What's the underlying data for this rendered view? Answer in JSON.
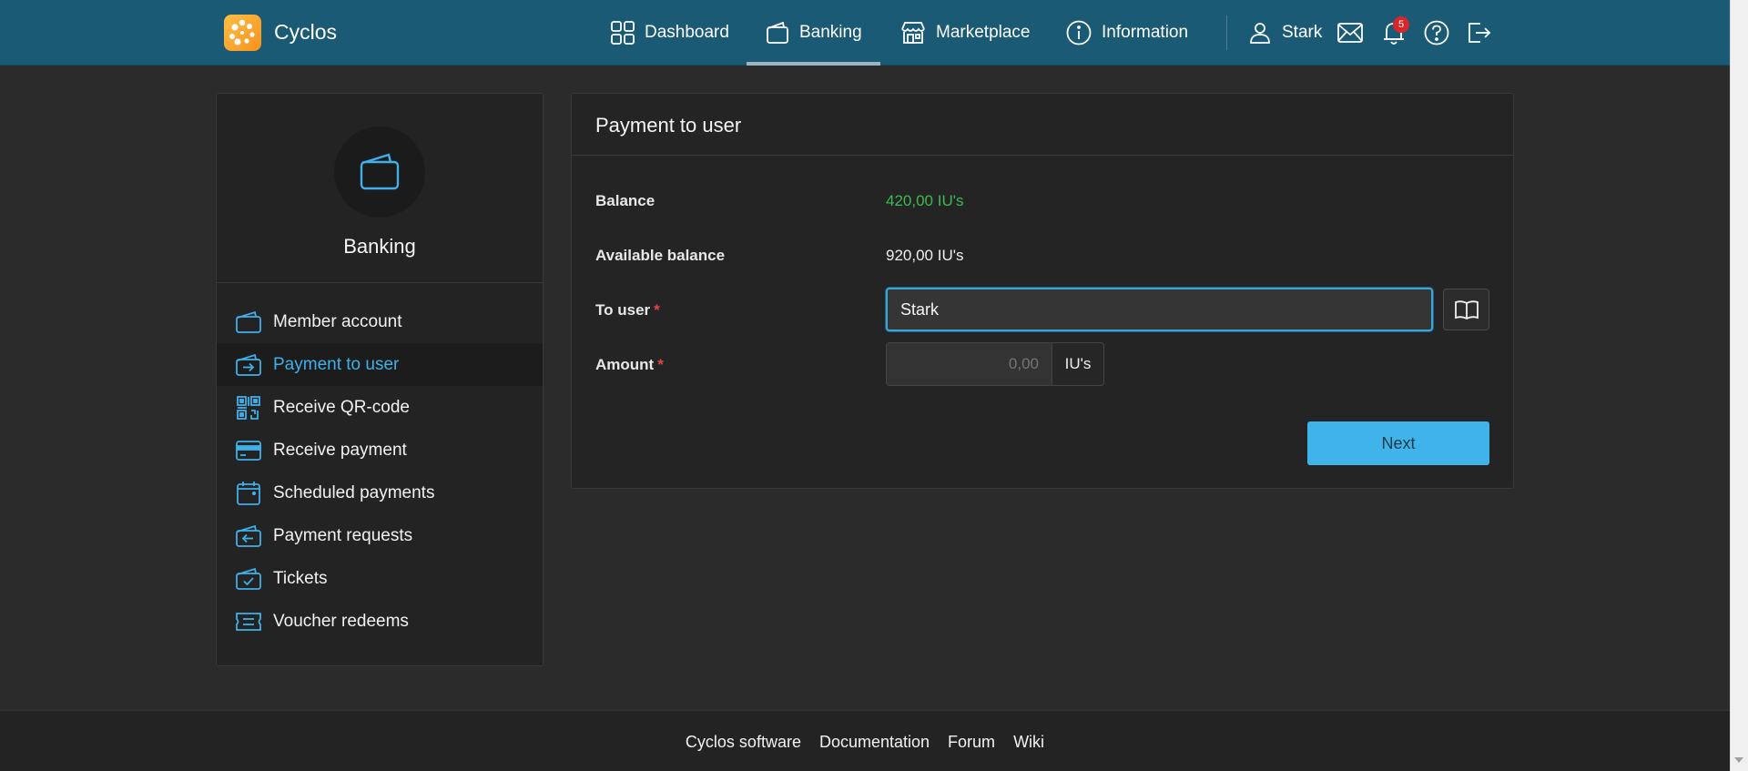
{
  "app": {
    "name": "Cyclos"
  },
  "topnav": {
    "items": [
      {
        "label": "Dashboard",
        "icon": "dashboard-icon"
      },
      {
        "label": "Banking",
        "icon": "wallet-icon",
        "active": true
      },
      {
        "label": "Marketplace",
        "icon": "store-icon"
      },
      {
        "label": "Information",
        "icon": "info-icon"
      }
    ],
    "user": "Stark",
    "notifications_count": "5"
  },
  "sidebar": {
    "title": "Banking",
    "items": [
      {
        "label": "Member account",
        "icon": "wallet-icon"
      },
      {
        "label": "Payment to user",
        "icon": "payment-out-icon",
        "active": true
      },
      {
        "label": "Receive QR-code",
        "icon": "qr-code-icon"
      },
      {
        "label": "Receive payment",
        "icon": "card-icon"
      },
      {
        "label": "Scheduled payments",
        "icon": "calendar-icon"
      },
      {
        "label": "Payment requests",
        "icon": "payment-in-icon"
      },
      {
        "label": "Tickets",
        "icon": "ticket-check-icon"
      },
      {
        "label": "Voucher redeems",
        "icon": "voucher-icon"
      }
    ]
  },
  "form": {
    "title": "Payment to user",
    "balance_label": "Balance",
    "balance_value": "420,00 IU's",
    "available_label": "Available balance",
    "available_value": "920,00 IU's",
    "to_user_label": "To user",
    "to_user_value": "Stark",
    "amount_label": "Amount",
    "amount_placeholder": "0,00",
    "amount_unit": "IU's",
    "required_mark": "*",
    "next_label": "Next"
  },
  "footer": {
    "links": [
      "Cyclos software",
      "Documentation",
      "Forum",
      "Wiki"
    ]
  },
  "colors": {
    "header_bg": "#1a5a74",
    "accent": "#40b4ea",
    "balance_green": "#3dbb52",
    "badge_red": "#d9262b"
  }
}
